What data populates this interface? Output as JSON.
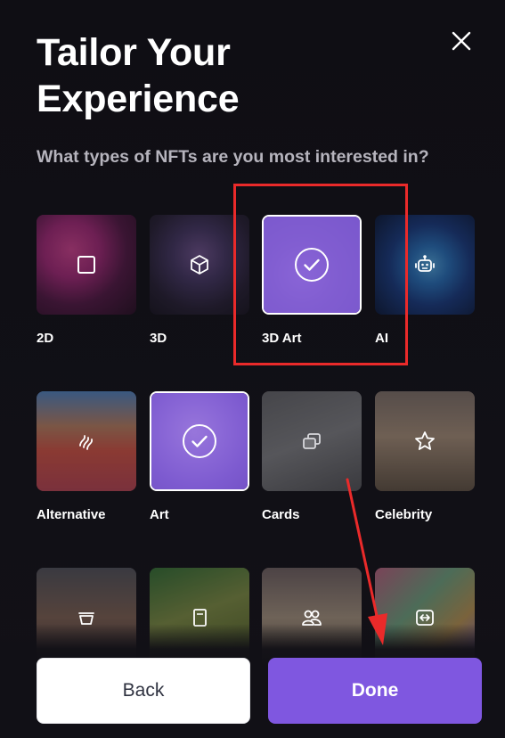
{
  "header": {
    "title": "Tailor Your Experience",
    "close_icon": "close-icon"
  },
  "question": "What types of NFTs are you most interested in?",
  "categories": [
    {
      "label": "2D",
      "icon": "square-icon",
      "selected": false
    },
    {
      "label": "3D",
      "icon": "cube-icon",
      "selected": false
    },
    {
      "label": "3D Art",
      "icon": "check-circle-icon",
      "selected": true
    },
    {
      "label": "AI",
      "icon": "robot-icon",
      "selected": false
    },
    {
      "label": "Alternative",
      "icon": "squiggle-icon",
      "selected": false
    },
    {
      "label": "Art",
      "icon": "check-circle-icon",
      "selected": true
    },
    {
      "label": "Cards",
      "icon": "cards-icon",
      "selected": false
    },
    {
      "label": "Celebrity",
      "icon": "star-icon",
      "selected": false
    },
    {
      "label": "",
      "icon": "bowl-icon",
      "selected": false
    },
    {
      "label": "",
      "icon": "book-icon",
      "selected": false
    },
    {
      "label": "",
      "icon": "people-icon",
      "selected": false
    },
    {
      "label": "",
      "icon": "swap-icon",
      "selected": false
    }
  ],
  "footer": {
    "back_label": "Back",
    "done_label": "Done"
  },
  "colors": {
    "accent": "#7f57e0",
    "annotation_red": "#ea2a2a"
  }
}
